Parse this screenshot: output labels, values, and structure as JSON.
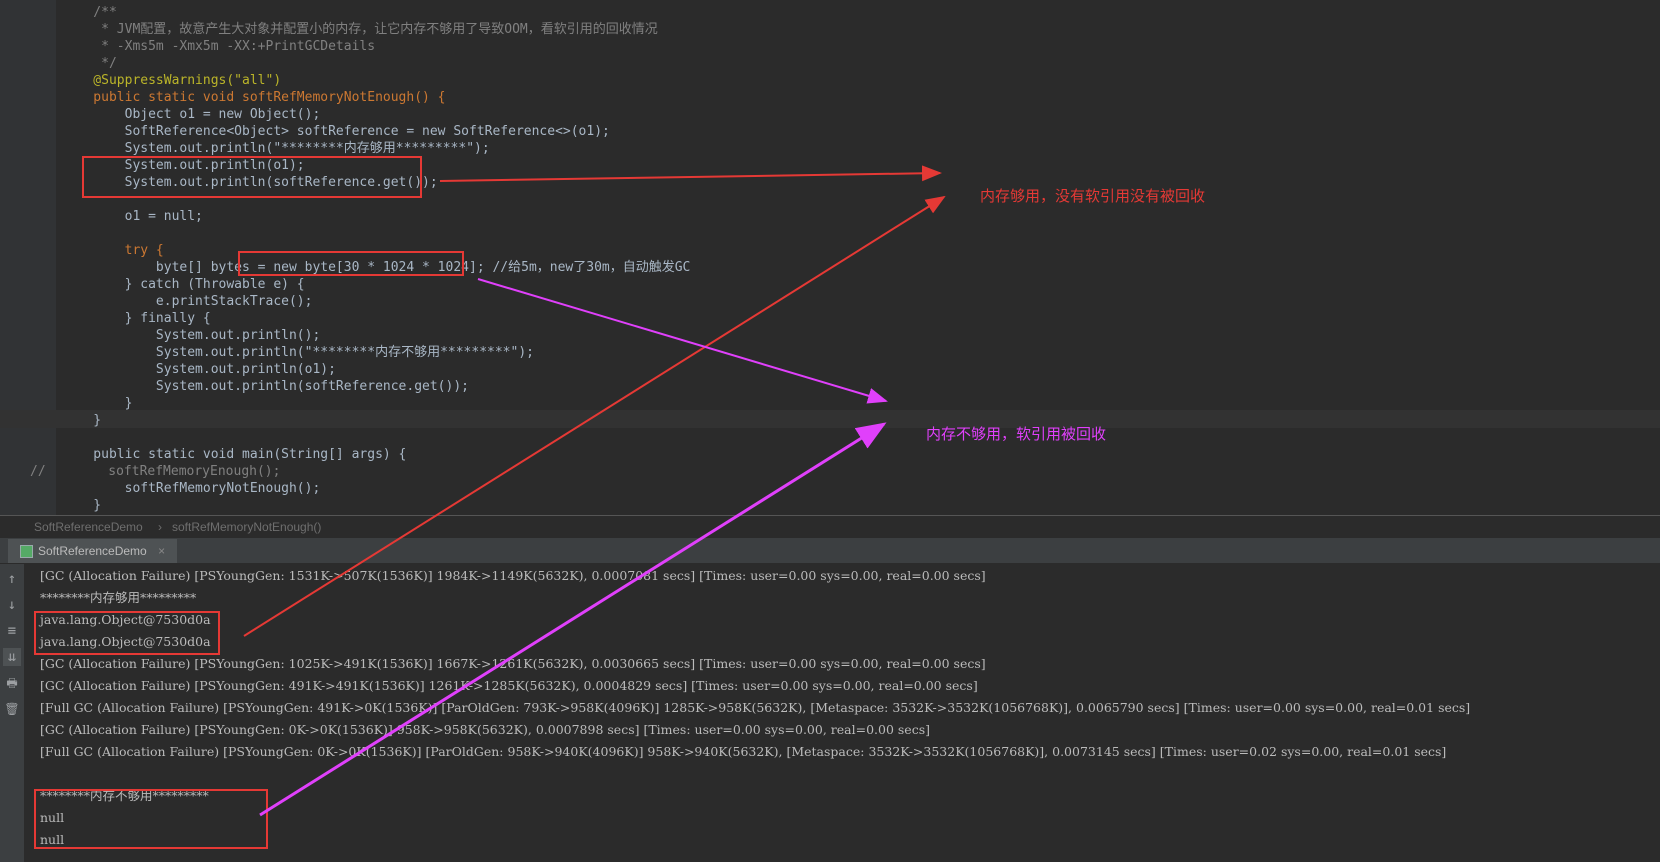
{
  "editor": {
    "lines": [
      "    /**",
      "     * JVM配置，故意产生大对象并配置小的内存，让它内存不够用了导致OOM，看软引用的回收情况",
      "     * -Xms5m -Xmx5m -XX:+PrintGCDetails",
      "     */",
      "    @SuppressWarnings(\"all\")",
      "    public static void softRefMemoryNotEnough() {",
      "        Object o1 = new Object();",
      "        SoftReference<Object> softReference = new SoftReference<>(o1);",
      "        System.out.println(\"********内存够用*********\");",
      "        System.out.println(o1);",
      "        System.out.println(softReference.get());",
      "",
      "        o1 = null;",
      "",
      "        try {",
      "            byte[] bytes = new byte[30 * 1024 * 1024]; //给5m，new了30m，自动触发GC",
      "        } catch (Throwable e) {",
      "            e.printStackTrace();",
      "        } finally {",
      "            System.out.println();",
      "            System.out.println(\"********内存不够用*********\");",
      "            System.out.println(o1);",
      "            System.out.println(softReference.get());",
      "        }",
      "    }",
      "",
      "    public static void main(String[] args) {",
      "//        softRefMemoryEnough();",
      "        softRefMemoryNotEnough();",
      "    }"
    ]
  },
  "breadcrumb": {
    "class_name": "SoftReferenceDemo",
    "separator": "›",
    "method_name": "softRefMemoryNotEnough()"
  },
  "run_panel": {
    "tab_label": "SoftReferenceDemo",
    "tab_close": "×",
    "tools": [
      "↑",
      "↓",
      "≡",
      "⇊",
      "🖶",
      "🗑"
    ]
  },
  "console": {
    "lines": [
      "[GC (Allocation Failure) [PSYoungGen: 1531K->507K(1536K)] 1984K->1149K(5632K), 0.0007081 secs] [Times: user=0.00 sys=0.00, real=0.00 secs]",
      "********内存够用*********",
      "java.lang.Object@7530d0a",
      "java.lang.Object@7530d0a",
      "[GC (Allocation Failure) [PSYoungGen: 1025K->491K(1536K)] 1667K->1261K(5632K), 0.0030665 secs] [Times: user=0.00 sys=0.00, real=0.00 secs]",
      "[GC (Allocation Failure) [PSYoungGen: 491K->491K(1536K)] 1261K->1285K(5632K), 0.0004829 secs] [Times: user=0.00 sys=0.00, real=0.00 secs]",
      "[Full GC (Allocation Failure) [PSYoungGen: 491K->0K(1536K)] [ParOldGen: 793K->958K(4096K)] 1285K->958K(5632K), [Metaspace: 3532K->3532K(1056768K)], 0.0065790 secs] [Times: user=0.00 sys=0.00, real=0.01 secs]",
      "[GC (Allocation Failure) [PSYoungGen: 0K->0K(1536K)] 958K->958K(5632K), 0.0007898 secs] [Times: user=0.00 sys=0.00, real=0.00 secs]",
      "[Full GC (Allocation Failure) [PSYoungGen: 0K->0K(1536K)] [ParOldGen: 958K->940K(4096K)] 958K->940K(5632K), [Metaspace: 3532K->3532K(1056768K)], 0.0073145 secs] [Times: user=0.02 sys=0.00, real=0.01 secs]",
      "",
      "********内存不够用*********",
      "null",
      "null"
    ]
  },
  "annotations": {
    "enough": "内存够用，没有软引用没有被回收",
    "not_enough": "内存不够用，软引用被回收"
  },
  "colors": {
    "red": "#e53935",
    "magenta": "#e040fb",
    "keyword": "#cc7832",
    "string": "#6a8759",
    "number": "#6897bb",
    "field": "#9876aa",
    "annotation": "#bbb529"
  }
}
